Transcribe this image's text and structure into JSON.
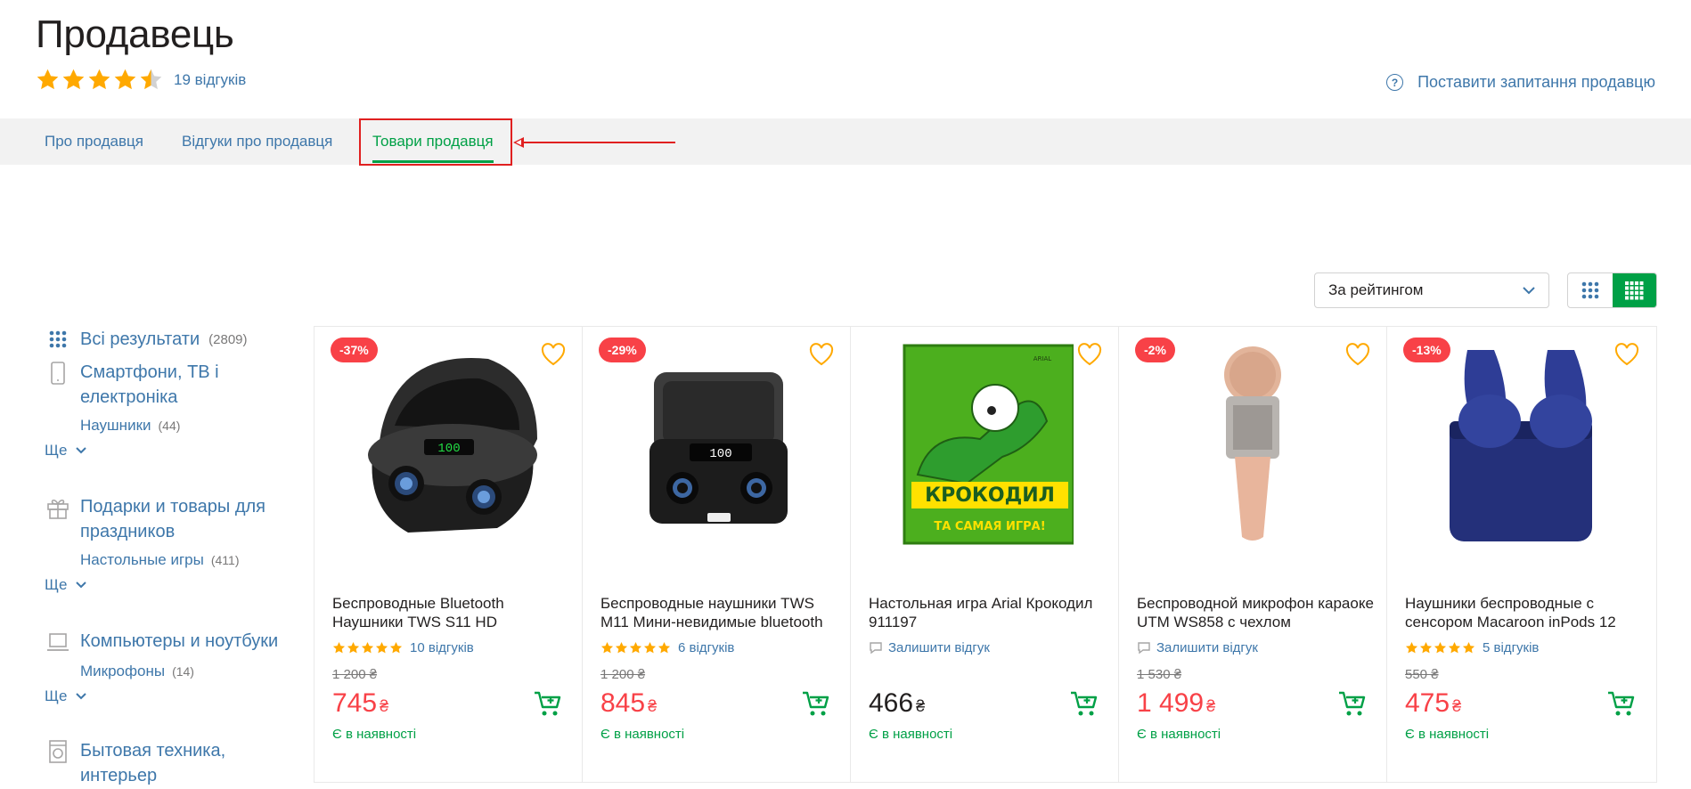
{
  "header": {
    "title": "Продавець",
    "rating_stars": 4.5,
    "reviews_link": "19 відгуків",
    "ask_link": "Поставити запитання продавцю"
  },
  "tabs": [
    {
      "label": "Про продавця",
      "active": false
    },
    {
      "label": "Відгуки про продавця",
      "active": false
    },
    {
      "label": "Товари продавця",
      "active": true
    }
  ],
  "toolbar": {
    "sort_value": "За рейтингом",
    "view_modes": [
      "large-grid",
      "small-grid"
    ],
    "active_view": "small-grid"
  },
  "sidebar": {
    "all_results": {
      "label": "Всі результати",
      "count": "(2809)"
    },
    "categories": [
      {
        "icon": "smartphone-icon",
        "title": "Смартфони, ТВ і електроніка",
        "sub": "Наушники",
        "sub_count": "(44)",
        "more": "Ще"
      },
      {
        "icon": "gift-icon",
        "title": "Подарки и товары для праздников",
        "sub": "Настольные игры",
        "sub_count": "(411)",
        "more": "Ще"
      },
      {
        "icon": "laptop-icon",
        "title": "Компьютеры и ноутбуки",
        "sub": "Микрофоны",
        "sub_count": "(14)",
        "more": "Ще"
      },
      {
        "icon": "washing-machine-icon",
        "title": "Бытовая техника, интерьер"
      }
    ]
  },
  "products": [
    {
      "badge": "-37%",
      "name": "Беспроводные Bluetooth Наушники TWS S11 HD",
      "stars": 5,
      "reviews": "10 відгуків",
      "old_price": "1 200 ₴",
      "price": "745",
      "currency": "₴",
      "availability": "Є в наявності",
      "image": "earbuds-case-black"
    },
    {
      "badge": "-29%",
      "name": "Беспроводные наушники TWS M11 Мини-невидимые bluetooth",
      "stars": 5,
      "reviews": "6 відгуків",
      "old_price": "1 200 ₴",
      "price": "845",
      "currency": "₴",
      "availability": "Є в наявності",
      "image": "earbuds-case-dark"
    },
    {
      "badge": "",
      "name": "Настольная игра Arial Крокодил 911197",
      "stars": 0,
      "reviews": "Залишити відгук",
      "old_price": "",
      "price": "466",
      "currency": "₴",
      "availability": "Є в наявності",
      "image": "board-game-box"
    },
    {
      "badge": "-2%",
      "name": "Беспроводной микрофон караоке UTM WS858 с чехлом",
      "stars": 0,
      "reviews": "Залишити відгук",
      "old_price": "1 530 ₴",
      "price": "1 499",
      "currency": "₴",
      "availability": "Є в наявності",
      "image": "karaoke-microphone"
    },
    {
      "badge": "-13%",
      "name": "Наушники беспроводные с сенсором Macaroon inPods 12",
      "stars": 5,
      "reviews": "5 відгуків",
      "old_price": "550 ₴",
      "price": "475",
      "currency": "₴",
      "availability": "Є в наявності",
      "image": "earbuds-blue"
    }
  ],
  "colors": {
    "accent": "#00a046",
    "link": "#3e77aa",
    "sale": "#f84147",
    "star": "#ffa900",
    "annotation": "#e02020"
  },
  "box_box_logo_text": {
    "game_title": "КРОКОДИЛ",
    "game_subtitle": "ТА САМАЯ ИГРА!",
    "brand": "ARIAL"
  }
}
